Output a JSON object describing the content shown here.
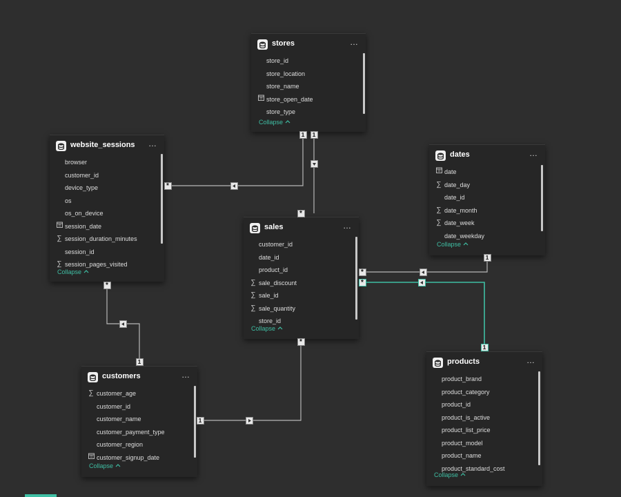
{
  "diagram": {
    "collapse_label": "Collapse",
    "more_label": "…",
    "tables": {
      "stores": {
        "name": "stores",
        "fields": [
          {
            "name": "store_id",
            "icon": ""
          },
          {
            "name": "store_location",
            "icon": ""
          },
          {
            "name": "store_name",
            "icon": ""
          },
          {
            "name": "store_open_date",
            "icon": "calendar"
          },
          {
            "name": "store_type",
            "icon": ""
          }
        ]
      },
      "website_sessions": {
        "name": "website_sessions",
        "fields": [
          {
            "name": "browser",
            "icon": ""
          },
          {
            "name": "customer_id",
            "icon": ""
          },
          {
            "name": "device_type",
            "icon": ""
          },
          {
            "name": "os",
            "icon": ""
          },
          {
            "name": "os_on_device",
            "icon": ""
          },
          {
            "name": "session_date",
            "icon": "calendar"
          },
          {
            "name": "session_duration_minutes",
            "icon": "sigma"
          },
          {
            "name": "session_id",
            "icon": ""
          },
          {
            "name": "session_pages_visited",
            "icon": "sigma"
          }
        ]
      },
      "dates": {
        "name": "dates",
        "fields": [
          {
            "name": "date",
            "icon": "calendar"
          },
          {
            "name": "date_day",
            "icon": "sigma"
          },
          {
            "name": "date_id",
            "icon": ""
          },
          {
            "name": "date_month",
            "icon": "sigma"
          },
          {
            "name": "date_week",
            "icon": "sigma"
          },
          {
            "name": "date_weekday",
            "icon": ""
          }
        ]
      },
      "sales": {
        "name": "sales",
        "fields": [
          {
            "name": "customer_id",
            "icon": ""
          },
          {
            "name": "date_id",
            "icon": ""
          },
          {
            "name": "product_id",
            "icon": ""
          },
          {
            "name": "sale_discount",
            "icon": "sigma"
          },
          {
            "name": "sale_id",
            "icon": "sigma"
          },
          {
            "name": "sale_quantity",
            "icon": "sigma"
          },
          {
            "name": "store_id",
            "icon": ""
          }
        ]
      },
      "customers": {
        "name": "customers",
        "fields": [
          {
            "name": "customer_age",
            "icon": "sigma"
          },
          {
            "name": "customer_id",
            "icon": ""
          },
          {
            "name": "customer_name",
            "icon": ""
          },
          {
            "name": "customer_payment_type",
            "icon": ""
          },
          {
            "name": "customer_region",
            "icon": ""
          },
          {
            "name": "customer_signup_date",
            "icon": "calendar"
          }
        ]
      },
      "products": {
        "name": "products",
        "fields": [
          {
            "name": "product_brand",
            "icon": ""
          },
          {
            "name": "product_category",
            "icon": ""
          },
          {
            "name": "product_id",
            "icon": ""
          },
          {
            "name": "product_is_active",
            "icon": ""
          },
          {
            "name": "product_list_price",
            "icon": ""
          },
          {
            "name": "product_model",
            "icon": ""
          },
          {
            "name": "product_name",
            "icon": ""
          },
          {
            "name": "product_standard_cost",
            "icon": ""
          }
        ]
      }
    },
    "relationships": [
      {
        "from": "website_sessions",
        "to": "stores",
        "from_cardinality": "*",
        "to_cardinality": "1",
        "active": true
      },
      {
        "from": "sales",
        "to": "stores",
        "from_cardinality": "*",
        "to_cardinality": "1",
        "active": true
      },
      {
        "from": "sales",
        "to": "dates",
        "from_cardinality": "*",
        "to_cardinality": "1",
        "active": true
      },
      {
        "from": "sales",
        "to": "products",
        "from_cardinality": "*",
        "to_cardinality": "1",
        "active": true,
        "highlighted": true
      },
      {
        "from": "website_sessions",
        "to": "customers",
        "from_cardinality": "*",
        "to_cardinality": "1",
        "active": true
      },
      {
        "from": "sales",
        "to": "customers",
        "from_cardinality": "*",
        "to_cardinality": "1",
        "active": true
      }
    ],
    "colors": {
      "background": "#2e2e2e",
      "card": "#262626",
      "line": "#b8b8b8",
      "highlight": "#3fbfa4",
      "text": "#dedede"
    }
  }
}
